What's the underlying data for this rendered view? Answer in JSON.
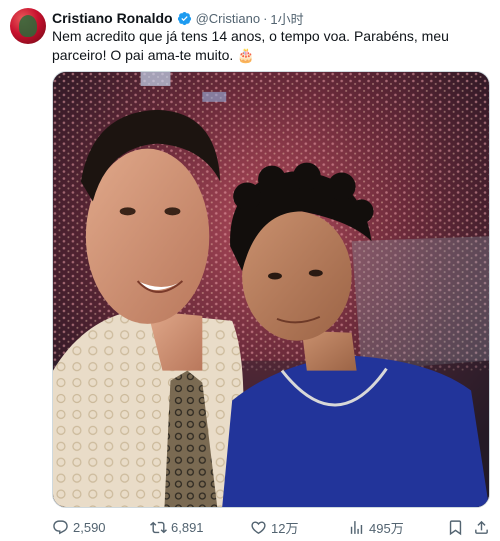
{
  "author": {
    "name": "Cristiano Ronaldo",
    "handle": "@Cristiano",
    "separator": "·",
    "time": "1小时",
    "verified_color": "#1d9bf0"
  },
  "tweet": {
    "text": "Nem acredito que já tens 14 anos, o tempo voa. Parabéns, meu parceiro! O pai ama-te muito. 🎂"
  },
  "media": {
    "icon": "photo-selfie"
  },
  "actions": {
    "replies": "2,590",
    "retweets": "6,891",
    "likes": "12万",
    "views": "495万"
  },
  "icons": [
    "reply-icon",
    "retweet-icon",
    "like-icon",
    "views-icon",
    "bookmark-icon",
    "share-icon"
  ]
}
